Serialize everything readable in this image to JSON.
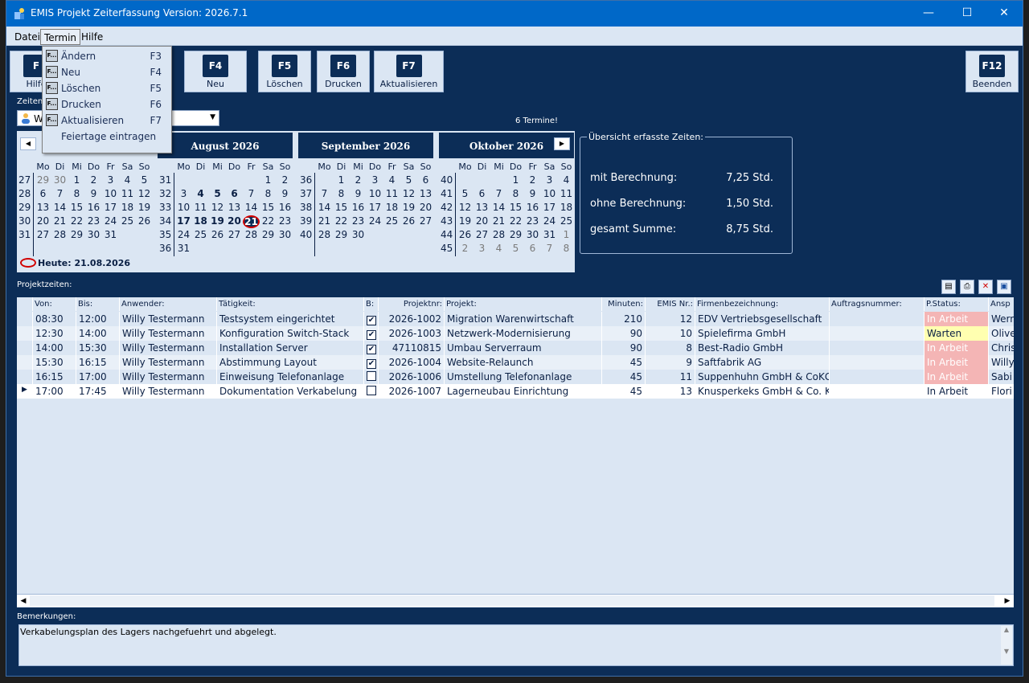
{
  "window": {
    "title": "EMIS Projekt Zeiterfassung Version: 2026.7.1",
    "minimize": "—",
    "maximize": "☐",
    "close": "✕"
  },
  "menu": {
    "datei": "Datei",
    "termin": "Termin",
    "hilfe": "Hilfe"
  },
  "dropdown": {
    "items": [
      {
        "label": "Ändern",
        "shortcut": "F3"
      },
      {
        "label": "Neu",
        "shortcut": "F4"
      },
      {
        "label": "Löschen",
        "shortcut": "F5"
      },
      {
        "label": "Drucken",
        "shortcut": "F6"
      },
      {
        "label": "Aktualisieren",
        "shortcut": "F7"
      },
      {
        "label": "Feiertage eintragen",
        "shortcut": ""
      }
    ],
    "icon_text": "F..."
  },
  "toolbar": {
    "buttons": [
      {
        "key": "F",
        "label": "Hilfe"
      },
      {
        "key": "F4",
        "label": "Neu"
      },
      {
        "key": "F5",
        "label": "Löschen"
      },
      {
        "key": "F6",
        "label": "Drucken"
      },
      {
        "key": "F7",
        "label": "Aktualisieren"
      },
      {
        "key": "F12",
        "label": "Beenden"
      }
    ]
  },
  "zeiten_label": "Zeiten",
  "user_select": {
    "value": "W"
  },
  "termine": "6 Termine!",
  "calendar": {
    "day_headers": [
      "Mo",
      "Di",
      "Mi",
      "Do",
      "Fr",
      "Sa",
      "So"
    ],
    "months": [
      {
        "title": "",
        "weeks": [
          "27",
          "28",
          "29",
          "30",
          "31"
        ],
        "rows": [
          [
            "29",
            "30",
            "1",
            "2",
            "3",
            "4",
            "5"
          ],
          [
            "6",
            "7",
            "8",
            "9",
            "10",
            "11",
            "12"
          ],
          [
            "13",
            "14",
            "15",
            "16",
            "17",
            "18",
            "19"
          ],
          [
            "20",
            "21",
            "22",
            "23",
            "24",
            "25",
            "26"
          ],
          [
            "27",
            "28",
            "29",
            "30",
            "31",
            "",
            ""
          ]
        ]
      },
      {
        "title": "August 2026",
        "weeks": [
          "31",
          "32",
          "33",
          "34",
          "35",
          "36"
        ],
        "rows": [
          [
            "",
            "",
            "",
            "",
            "",
            "1",
            "2"
          ],
          [
            "3",
            "4",
            "5",
            "6",
            "7",
            "8",
            "9"
          ],
          [
            "10",
            "11",
            "12",
            "13",
            "14",
            "15",
            "16"
          ],
          [
            "17",
            "18",
            "19",
            "20",
            "21",
            "22",
            "23"
          ],
          [
            "24",
            "25",
            "26",
            "27",
            "28",
            "29",
            "30"
          ],
          [
            "31",
            "",
            "",
            "",
            "",
            "",
            ""
          ]
        ]
      },
      {
        "title": "September 2026",
        "weeks": [
          "36",
          "37",
          "38",
          "39",
          "40"
        ],
        "rows": [
          [
            "",
            "1",
            "2",
            "3",
            "4",
            "5",
            "6"
          ],
          [
            "7",
            "8",
            "9",
            "10",
            "11",
            "12",
            "13"
          ],
          [
            "14",
            "15",
            "16",
            "17",
            "18",
            "19",
            "20"
          ],
          [
            "21",
            "22",
            "23",
            "24",
            "25",
            "26",
            "27"
          ],
          [
            "28",
            "29",
            "30",
            "",
            "",
            "",
            ""
          ]
        ]
      },
      {
        "title": "Oktober 2026",
        "weeks": [
          "40",
          "41",
          "42",
          "43",
          "44",
          "45"
        ],
        "rows": [
          [
            "",
            "",
            "",
            "1",
            "2",
            "3",
            "4"
          ],
          [
            "5",
            "6",
            "7",
            "8",
            "9",
            "10",
            "11"
          ],
          [
            "12",
            "13",
            "14",
            "15",
            "16",
            "17",
            "18"
          ],
          [
            "19",
            "20",
            "21",
            "22",
            "23",
            "24",
            "25"
          ],
          [
            "26",
            "27",
            "28",
            "29",
            "30",
            "31",
            "1"
          ],
          [
            "2",
            "3",
            "4",
            "5",
            "6",
            "7",
            "8"
          ]
        ]
      }
    ],
    "today": "Heute: 21.08.2026",
    "nav_prev": "◀",
    "nav_next": "▶"
  },
  "summary": {
    "title": "Übersicht erfasste Zeiten:",
    "rows": [
      {
        "label": "mit Berechnung:",
        "value": "7,25 Std."
      },
      {
        "label": "ohne Berechnung:",
        "value": "1,50 Std."
      },
      {
        "label": "gesamt Summe:",
        "value": "8,75 Std."
      }
    ]
  },
  "projektzeiten_label": "Projektzeiten:",
  "grid": {
    "headers": [
      "Von:",
      "Bis:",
      "Anwender:",
      "Tätigkeit:",
      "B:",
      "Projektnr:",
      "Projekt:",
      "Minuten:",
      "EMIS Nr.:",
      "Firmenbezeichnung:",
      "Auftragsnummer:",
      "P.Status:",
      "Ansp"
    ],
    "rows": [
      [
        "08:30",
        "12:00",
        "Willy Testermann",
        "Testsystem eingerichtet",
        "✔",
        "2026-1002",
        "Migration Warenwirtschaft",
        "210",
        "12",
        "EDV Vertriebsgesellschaft",
        "",
        "In Arbeit",
        "Wern"
      ],
      [
        "12:30",
        "14:00",
        "Willy Testermann",
        "Konfiguration Switch-Stack",
        "✔",
        "2026-1003",
        "Netzwerk-Modernisierung",
        "90",
        "10",
        "Spielefirma GmbH",
        "",
        "Warten",
        "Olive"
      ],
      [
        "14:00",
        "15:30",
        "Willy Testermann",
        "Installation Server",
        "✔",
        "47110815",
        "Umbau Serverraum",
        "90",
        "8",
        "Best-Radio GmbH",
        "",
        "In Arbeit",
        "Chris"
      ],
      [
        "15:30",
        "16:15",
        "Willy Testermann",
        "Abstimmung Layout",
        "✔",
        "2026-1004",
        "Website-Relaunch",
        "45",
        "9",
        "Saftfabrik AG",
        "",
        "In Arbeit",
        "Willy"
      ],
      [
        "16:15",
        "17:00",
        "Willy Testermann",
        "Einweisung Telefonanlage",
        "",
        "2026-1006",
        "Umstellung Telefonanlage",
        "45",
        "11",
        "Suppenhuhn GmbH & CoKG",
        "",
        "In Arbeit",
        "Sabi"
      ],
      [
        "17:00",
        "17:45",
        "Willy Testermann",
        "Dokumentation Verkabelung",
        "",
        "2026-1007",
        "Lagerneubau Einrichtung",
        "45",
        "13",
        "Knusperkeks GmbH & Co. KG",
        "",
        "In Arbeit",
        "Flori"
      ]
    ],
    "status_colors": [
      "red",
      "yellow",
      "red",
      "red",
      "red",
      "none"
    ],
    "row_pointer": "▶"
  },
  "bemerkungen_label": "Bemerkungen:",
  "bemerkungen_text": "Verkabelungsplan des Lagers nachgefuehrt und abgelegt.",
  "colors": {
    "background": "#0c2d57",
    "panel": "#dbe6f3",
    "titlebar": "#0068c8",
    "status_red": "#f4b5b5",
    "status_yellow": "#ffffb0"
  }
}
